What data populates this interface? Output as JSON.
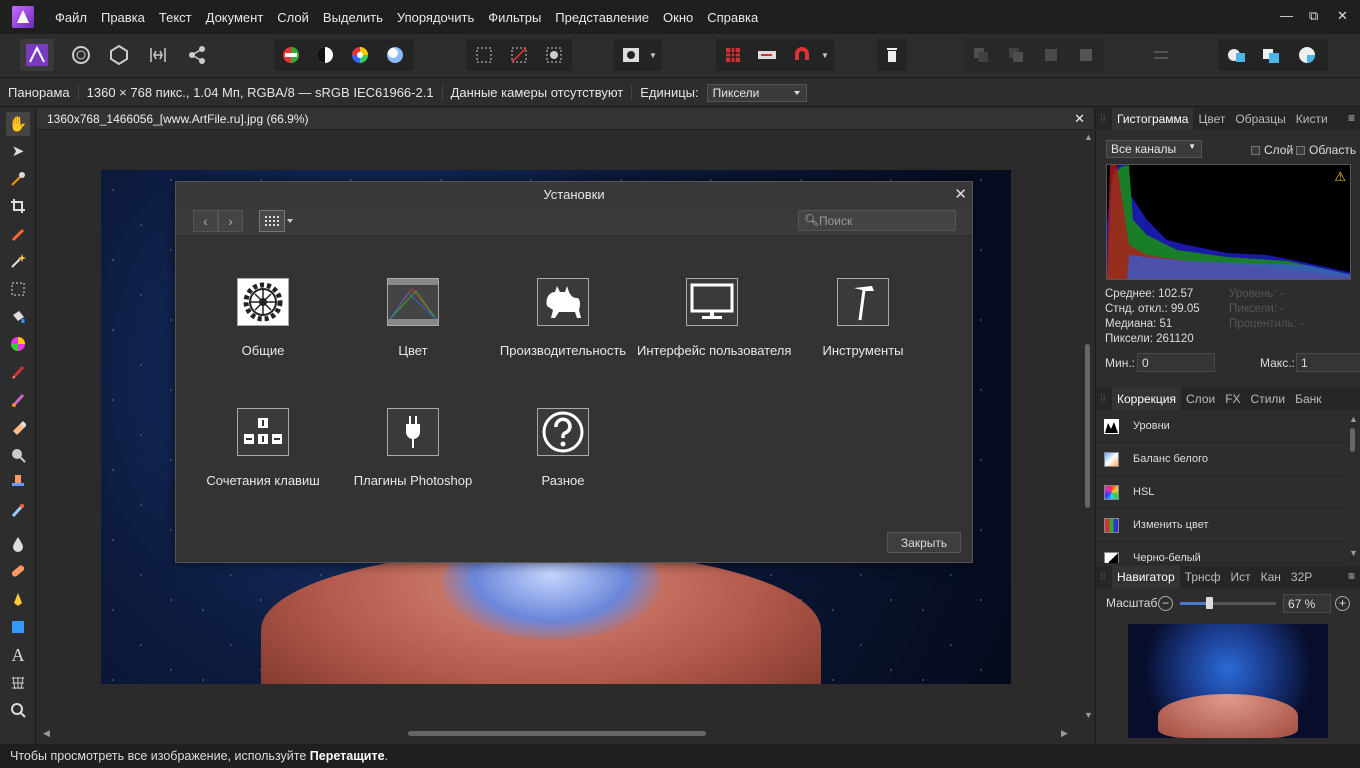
{
  "menu": [
    "Файл",
    "Правка",
    "Текст",
    "Документ",
    "Слой",
    "Выделить",
    "Упорядочить",
    "Фильтры",
    "Представление",
    "Окно",
    "Справка"
  ],
  "window_controls": [
    "—",
    "⧉",
    "✕"
  ],
  "context": {
    "persona": "Панорама",
    "info": "1360 × 768 пикс., 1.04 Мп, RGBA/8 — sRGB IEC61966-2.1",
    "camera": "Данные камеры отсутствуют",
    "units_label": "Единицы:",
    "units_value": "Пиксели"
  },
  "document": {
    "tab_title": "1360x768_1466056_[www.ArtFile.ru].jpg (66.9%)"
  },
  "dialog": {
    "title": "Установки",
    "search_placeholder": "Поиск",
    "items": [
      {
        "label": "Общие"
      },
      {
        "label": "Цвет"
      },
      {
        "label": "Производительность"
      },
      {
        "label": "Интерфейс пользователя"
      },
      {
        "label": "Инструменты"
      },
      {
        "label": "Сочетания клавиш"
      },
      {
        "label": "Плагины Photoshop"
      },
      {
        "label": "Разное"
      }
    ],
    "close_button": "Закрыть"
  },
  "histogram_panel": {
    "tabs": [
      "Гистограмма",
      "Цвет",
      "Образцы",
      "Кисти"
    ],
    "channel": "Все каналы",
    "layer_check": "Слой",
    "area_check": "Область",
    "stats": [
      "Среднее: 102.57",
      "Стнд. откл.: 99.05",
      "Медиана: 51",
      "Пиксели: 261120"
    ],
    "stats_dim": [
      "Уровень: -",
      "Пиксели: -",
      "Процентиль: -"
    ],
    "min_label": "Мин.:",
    "min_value": "0",
    "max_label": "Макс.:",
    "max_value": "1"
  },
  "adjust_panel": {
    "tabs": [
      "Коррекция",
      "Слои",
      "FX",
      "Стили",
      "Банк"
    ],
    "items": [
      "Уровни",
      "Баланс белого",
      "HSL",
      "Изменить цвет",
      "Черно-белый"
    ]
  },
  "navigator_panel": {
    "tabs": [
      "Навигатор",
      "Трнсф",
      "Ист",
      "Кан",
      "32Р"
    ],
    "zoom_label": "Масштаб:",
    "zoom_value": "67 %",
    "zoom_level_fraction": 0.3
  },
  "status": {
    "text": "Чтобы просмотреть все изображение, используйте ",
    "bold": "Перетащите",
    "end": "."
  }
}
